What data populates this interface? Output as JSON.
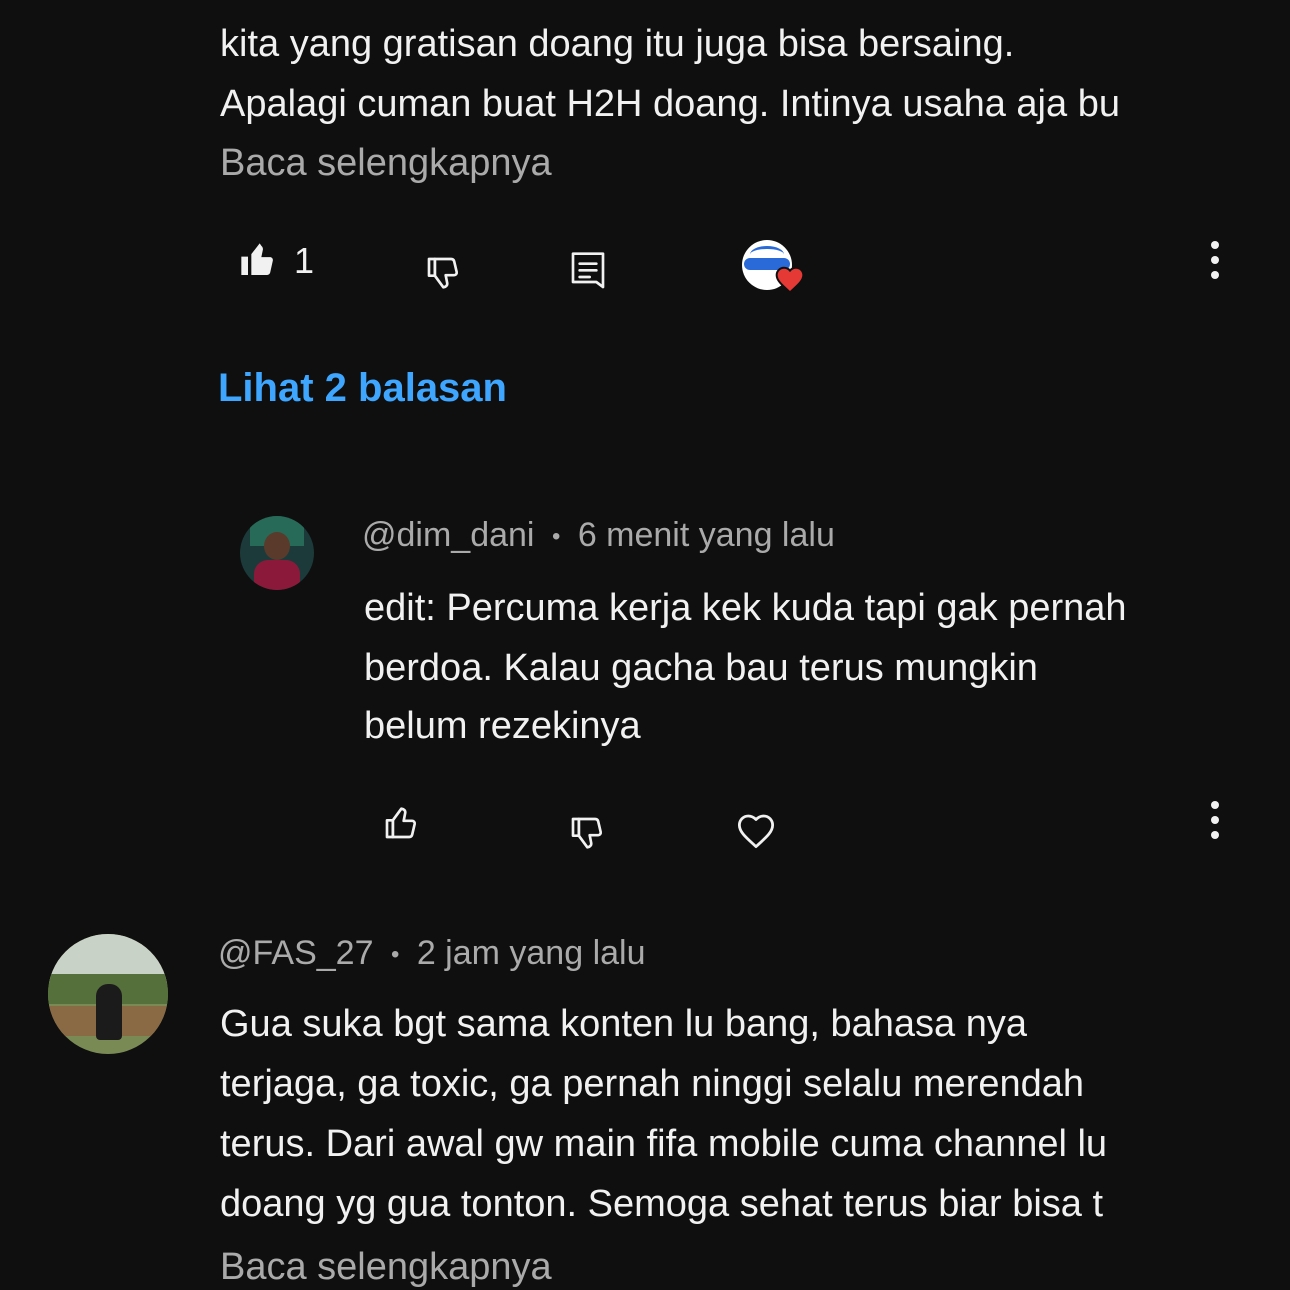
{
  "comment1": {
    "text_lines": [
      "kita yang gratisan doang itu juga bisa bersaing.",
      "Apalagi cuman buat H2H doang. Intinya usaha aja bu"
    ],
    "read_more": "Baca selengkapnya",
    "like_count": "1",
    "view_replies": "Lihat 2 balasan"
  },
  "reply1": {
    "handle": "@dim_dani",
    "separator": "•",
    "time": "6 menit yang lalu",
    "text_lines": [
      "edit: Percuma kerja kek kuda tapi gak pernah",
      "berdoa. Kalau gacha bau terus mungkin",
      "belum rezekinya"
    ]
  },
  "comment2": {
    "handle": "@FAS_27",
    "separator": "•",
    "time": "2 jam yang lalu",
    "text_lines": [
      "Gua suka bgt sama konten lu bang, bahasa nya",
      "terjaga, ga toxic, ga pernah ninggi selalu merendah",
      "terus. Dari awal gw main fifa mobile cuma channel lu",
      "doang yg gua tonton. Semoga sehat terus biar bisa t"
    ],
    "read_more": "Baca selengkapnya"
  },
  "icons": {
    "like": "thumbs-up-icon",
    "dislike": "thumbs-down-icon",
    "reply": "comment-reply-icon",
    "heart": "heart-icon",
    "more": "more-vertical-icon"
  },
  "colors": {
    "background": "#0f0f0f",
    "text": "#f1f1f1",
    "secondary": "#aaaaaa",
    "link": "#3ea6ff",
    "heart": "#e53935"
  }
}
